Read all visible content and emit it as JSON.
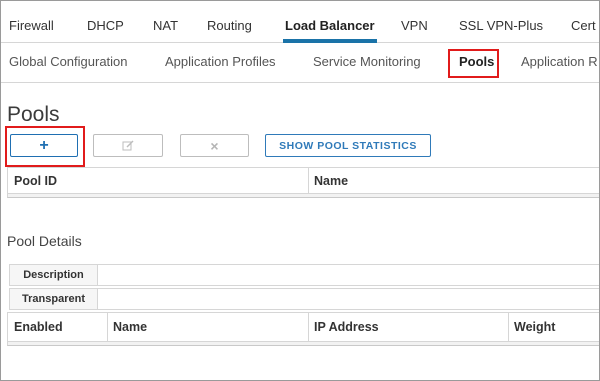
{
  "top_tabs": [
    {
      "label": "Firewall"
    },
    {
      "label": "DHCP"
    },
    {
      "label": "NAT"
    },
    {
      "label": "Routing"
    },
    {
      "label": "Load Balancer",
      "active": true
    },
    {
      "label": "VPN"
    },
    {
      "label": "SSL VPN-Plus"
    },
    {
      "label": "Cert"
    }
  ],
  "sub_tabs": [
    {
      "label": "Global Configuration"
    },
    {
      "label": "Application Profiles"
    },
    {
      "label": "Service Monitoring"
    },
    {
      "label": "Pools",
      "active": true,
      "highlighted": true
    },
    {
      "label": "Application R"
    }
  ],
  "page_title": "Pools",
  "toolbar": {
    "add_glyph": "+",
    "edit_icon": "edit-icon",
    "delete_glyph": "×",
    "stats_label": "SHOW POOL STATISTICS",
    "add_highlighted": true
  },
  "pools_table": {
    "columns": [
      "Pool ID",
      "Name"
    ],
    "rows": []
  },
  "details": {
    "title": "Pool Details",
    "properties": [
      {
        "label": "Description",
        "value": ""
      },
      {
        "label": "Transparent",
        "value": ""
      }
    ],
    "members_columns": [
      "Enabled",
      "Name",
      "IP Address",
      "Weight"
    ],
    "members_rows": []
  },
  "colors": {
    "accent": "#1f6fb2",
    "highlight": "#e11b1b",
    "tab_underline": "#1a73a8"
  }
}
